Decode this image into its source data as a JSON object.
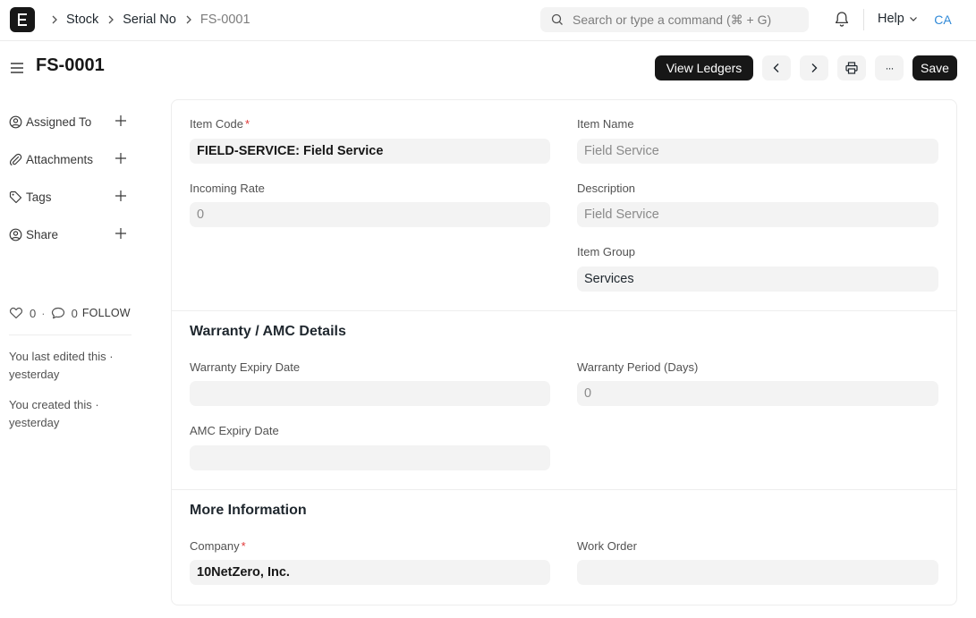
{
  "navbar": {
    "breadcrumbs": [
      "Stock",
      "Serial No",
      "FS-0001"
    ],
    "search_placeholder": "Search or type a command (⌘ + G)",
    "help_label": "Help",
    "user_initials": "CA"
  },
  "page": {
    "title": "FS-0001",
    "actions": {
      "view_ledgers": "View Ledgers",
      "more": "···",
      "save": "Save"
    }
  },
  "sidebar": {
    "items": [
      {
        "label": "Assigned To",
        "icon": "assign-icon"
      },
      {
        "label": "Attachments",
        "icon": "paperclip-icon"
      },
      {
        "label": "Tags",
        "icon": "tag-icon"
      },
      {
        "label": "Share",
        "icon": "share-icon"
      }
    ],
    "likes": "0",
    "comments": "0",
    "dot": "·",
    "follow_label": "FOLLOW",
    "last_edited": "You last edited this · yesterday",
    "created": "You created this · yesterday"
  },
  "form": {
    "item_code": {
      "label": "Item Code",
      "required_mark": "*",
      "value": "FIELD-SERVICE: Field Service"
    },
    "item_name": {
      "label": "Item Name",
      "value": "Field Service"
    },
    "incoming_rate": {
      "label": "Incoming Rate",
      "value": "0"
    },
    "description": {
      "label": "Description",
      "value": "Field Service"
    },
    "item_group": {
      "label": "Item Group",
      "value": "Services"
    },
    "warranty_section": {
      "title": "Warranty / AMC Details",
      "warranty_expiry_date": {
        "label": "Warranty Expiry Date",
        "value": ""
      },
      "warranty_period": {
        "label": "Warranty Period (Days)",
        "value": "0"
      },
      "amc_expiry_date": {
        "label": "AMC Expiry Date",
        "value": ""
      }
    },
    "more_info_section": {
      "title": "More Information",
      "company": {
        "label": "Company",
        "required_mark": "*",
        "value": "10NetZero, Inc."
      },
      "work_order": {
        "label": "Work Order",
        "value": ""
      }
    }
  },
  "colors": {
    "primary_dark": "#171717",
    "required": "#e03636",
    "avatar_text": "#318ad8",
    "control_bg": "#f3f3f3"
  }
}
